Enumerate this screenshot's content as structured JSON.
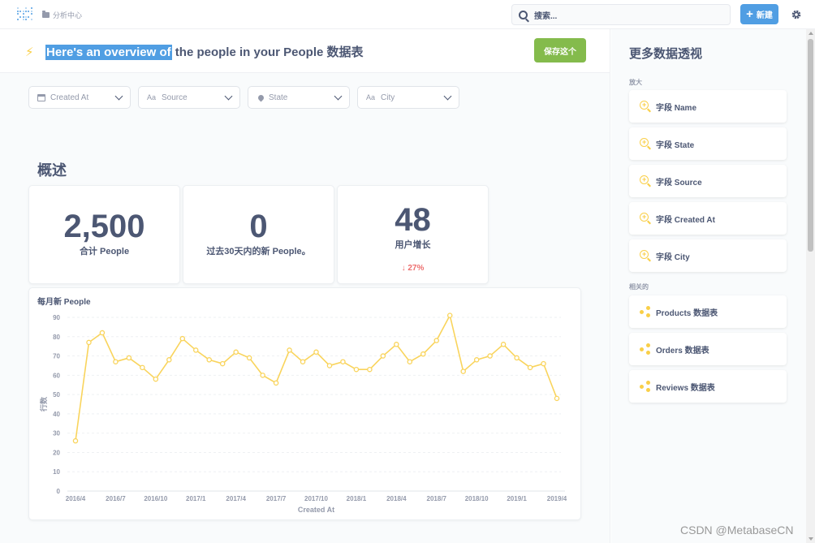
{
  "topbar": {
    "breadcrumb": "分析中心",
    "search_placeholder": "搜索...",
    "new_label": "新建"
  },
  "header": {
    "title_highlight": "Here's an overview of",
    "title_rest": " the people in your People 数据表",
    "save_label": "保存这个"
  },
  "filters": [
    {
      "label": "Created At",
      "icon": "calendar-icon"
    },
    {
      "label": "Source",
      "icon": "text-aa-icon"
    },
    {
      "label": "State",
      "icon": "location-pin-icon"
    },
    {
      "label": "City",
      "icon": "text-aa-icon"
    }
  ],
  "section_title": "概述",
  "scalars": [
    {
      "value": "2,500",
      "label": "合计 People"
    },
    {
      "value": "0",
      "label": "过去30天内的新 People。"
    },
    {
      "value": "48",
      "label": "用户增长",
      "change": "27%"
    }
  ],
  "sidebar": {
    "title": "更多数据透视",
    "zoom_heading": "放大",
    "zoom_items": [
      "字段 Name",
      "字段 State",
      "字段 Source",
      "字段 Created At",
      "字段 City"
    ],
    "related_heading": "相关的",
    "related_items": [
      "Products 数据表",
      "Orders 数据表",
      "Reviews 数据表"
    ]
  },
  "watermark": "CSDN @MetabaseCN",
  "colors": {
    "accent": "#509ee3",
    "save": "#84bb4c",
    "line": "#f9d45c",
    "negative": "#ed6e6e"
  },
  "chart_data": {
    "type": "line",
    "title": "每月新 People",
    "xlabel": "Created At",
    "ylabel": "行数",
    "ylim": [
      0,
      90
    ],
    "yticks": [
      0,
      10,
      20,
      30,
      40,
      50,
      60,
      70,
      80,
      90
    ],
    "xtick_labels": [
      "2016/4",
      "2016/7",
      "2016/10",
      "2017/1",
      "2017/4",
      "2017/7",
      "2017/10",
      "2018/1",
      "2018/4",
      "2018/7",
      "2018/10",
      "2019/1",
      "2019/4"
    ],
    "series": [
      {
        "values": [
          26,
          77,
          82,
          67,
          69,
          64,
          58,
          68,
          79,
          73,
          68,
          66,
          72,
          69,
          60,
          56,
          73,
          67,
          72,
          65,
          67,
          63,
          63,
          70,
          76,
          67,
          71,
          78,
          91,
          62,
          68,
          70,
          76,
          69,
          64,
          66,
          48
        ]
      }
    ]
  }
}
